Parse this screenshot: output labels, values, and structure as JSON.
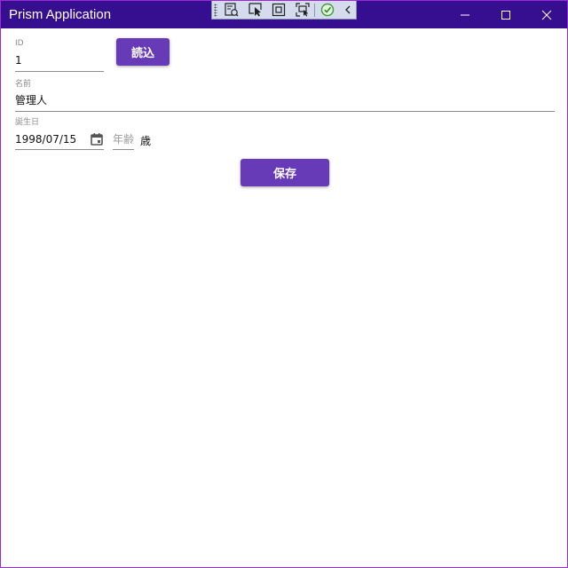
{
  "window": {
    "title": "Prism Application"
  },
  "form": {
    "id": {
      "label": "ID",
      "value": "1"
    },
    "load_button": "読込",
    "name": {
      "label": "名前",
      "value": "管理人"
    },
    "birthdate": {
      "label": "誕生日",
      "value": "1998/07/15"
    },
    "age": {
      "placeholder": "年齢",
      "unit": "歳"
    },
    "save_button": "保存"
  },
  "colors": {
    "titlebar": "#350f8f",
    "accent": "#673ab7"
  }
}
